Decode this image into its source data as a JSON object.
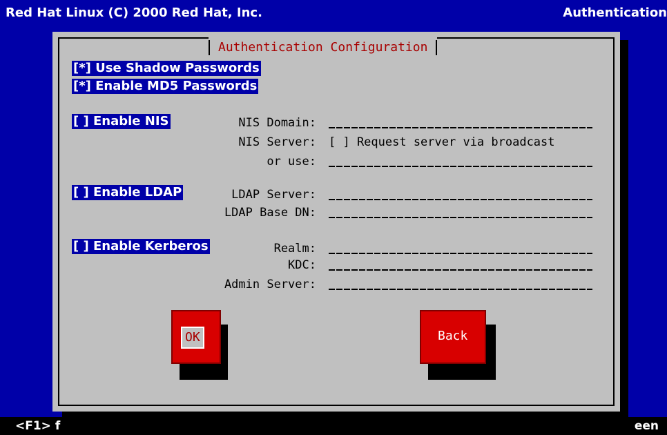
{
  "topbar": {
    "left_text": "Red Hat Linux (C) 2000 Red Hat, Inc.",
    "right_text": "Authentication"
  },
  "dialog": {
    "title": "Authentication Configuration"
  },
  "options": {
    "shadow": "[*] Use Shadow Passwords",
    "md5": "[*] Enable MD5 Passwords",
    "nis": "[ ] Enable NIS",
    "ldap": "[ ] Enable LDAP",
    "kerberos": "[ ] Enable Kerberos"
  },
  "nis": {
    "domain_label": "NIS Domain:",
    "server_label": "NIS Server:",
    "broadcast": "[ ] Request server via broadcast",
    "or_use_label": "or use:"
  },
  "ldap": {
    "server_label": "LDAP Server:",
    "base_dn_label": "LDAP Base DN:"
  },
  "kerberos": {
    "realm_label": "Realm:",
    "kdc_label": "KDC:",
    "admin_label": "Admin Server:"
  },
  "buttons": {
    "ok": "OK",
    "back": "Back"
  },
  "bottombar": {
    "left_text": "<F1> f",
    "right_text": "een"
  },
  "colors": {
    "background": "#0000a8",
    "dialog": "#c0c0c0",
    "title": "#a80000",
    "button": "#d80000"
  }
}
